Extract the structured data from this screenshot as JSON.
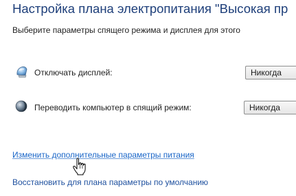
{
  "header": {
    "title": "Настройка плана электропитания \"Высокая пр",
    "subtitle": "Выберите параметры спящего режима и дисплея для этого"
  },
  "settings": [
    {
      "icon": "display-power-icon",
      "label": "Отключать дисплей:",
      "value": "Никогда"
    },
    {
      "icon": "sleep-moon-icon",
      "label": "Переводить компьютер в спящий режим:",
      "value": "Никогда"
    }
  ],
  "links": {
    "advanced": "Изменить дополнительные параметры питания",
    "restore": "Восстановить для плана параметры по умолчанию"
  },
  "cursor": "hand-pointer-icon"
}
